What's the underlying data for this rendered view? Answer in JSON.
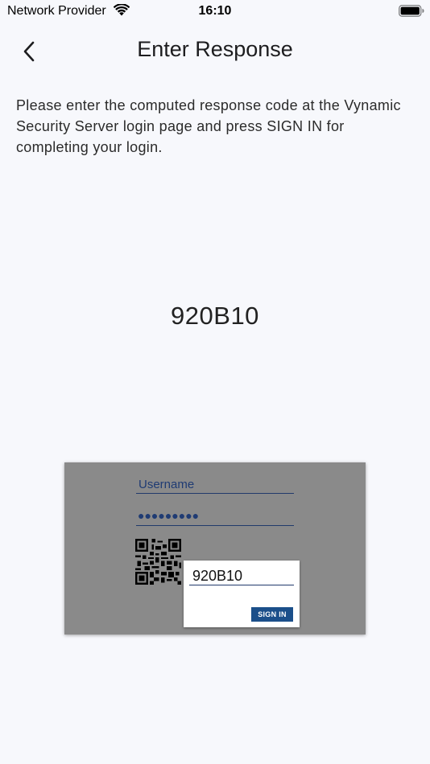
{
  "status_bar": {
    "carrier": "Network Provider",
    "time": "16:10",
    "icons": [
      "wifi-icon",
      "battery-icon"
    ]
  },
  "nav": {
    "back_icon": "chevron-left-icon",
    "title": "Enter Response"
  },
  "instructions": "Please enter the computed response code at the Vynamic Security Server login page and press SIGN IN for completing your login.",
  "response_code": "920B10",
  "illustration": {
    "username_label": "Username",
    "password_mask": "●●●●●●●●●",
    "qr_icon": "qr-code-icon",
    "popup_code": "920B10",
    "signin_label": "SIGN IN",
    "colors": {
      "background": "#8a8a8a",
      "field_text": "#1f3b73",
      "signin_button": "#1b4f8a"
    }
  }
}
